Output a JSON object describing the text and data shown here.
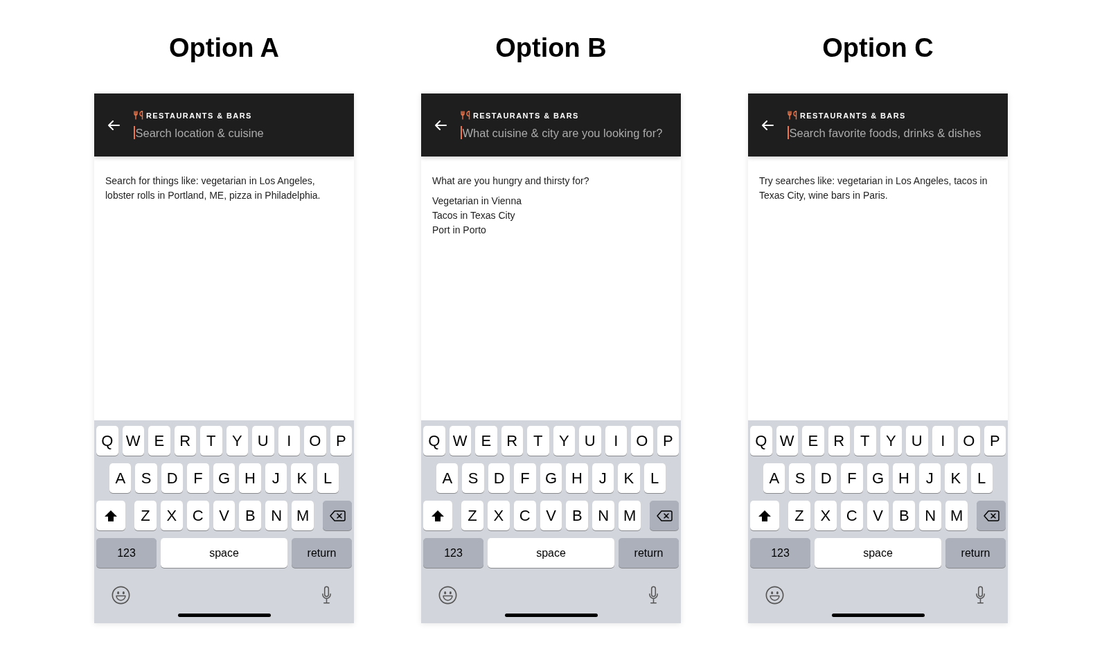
{
  "options": [
    {
      "title": "Option A",
      "header": {
        "category": "RESTAURANTS & BARS",
        "search": {
          "placeholder": "Search location & cuisine",
          "focused": true
        }
      },
      "hint": "Search for things like: vegetarian in Los Angeles, lobster rolls in Portland, ME, pizza in Philadelphia.",
      "keyboard": {
        "letter_rows": [
          [
            "Q",
            "W",
            "E",
            "R",
            "T",
            "Y",
            "U",
            "I",
            "O",
            "P"
          ],
          [
            "A",
            "S",
            "D",
            "F",
            "G",
            "H",
            "J",
            "K",
            "L"
          ],
          [
            "Z",
            "X",
            "C",
            "V",
            "B",
            "N",
            "M"
          ]
        ],
        "mode_key": "123",
        "space_key": "space",
        "return_key": "return"
      }
    },
    {
      "title": "Option B",
      "header": {
        "category": "RESTAURANTS & BARS",
        "search": {
          "placeholder": "What cuisine & city are you looking for?",
          "focused": true
        }
      },
      "hint": "What are you hungry and thirsty for?",
      "suggestions": [
        "Vegetarian in Vienna",
        "Tacos in Texas City",
        "Port in Porto"
      ],
      "keyboard": {
        "letter_rows": [
          [
            "Q",
            "W",
            "E",
            "R",
            "T",
            "Y",
            "U",
            "I",
            "O",
            "P"
          ],
          [
            "A",
            "S",
            "D",
            "F",
            "G",
            "H",
            "J",
            "K",
            "L"
          ],
          [
            "Z",
            "X",
            "C",
            "V",
            "B",
            "N",
            "M"
          ]
        ],
        "mode_key": "123",
        "space_key": "space",
        "return_key": "return"
      }
    },
    {
      "title": "Option C",
      "header": {
        "category": "RESTAURANTS & BARS",
        "search": {
          "placeholder": "Search favorite foods, drinks & dishes",
          "focused": true
        }
      },
      "hint": "Try searches like: vegetarian in Los Angeles, tacos in Texas City, wine bars in Paris.",
      "keyboard": {
        "letter_rows": [
          [
            "Q",
            "W",
            "E",
            "R",
            "T",
            "Y",
            "U",
            "I",
            "O",
            "P"
          ],
          [
            "A",
            "S",
            "D",
            "F",
            "G",
            "H",
            "J",
            "K",
            "L"
          ],
          [
            "Z",
            "X",
            "C",
            "V",
            "B",
            "N",
            "M"
          ]
        ],
        "mode_key": "123",
        "space_key": "space",
        "return_key": "return"
      }
    }
  ]
}
